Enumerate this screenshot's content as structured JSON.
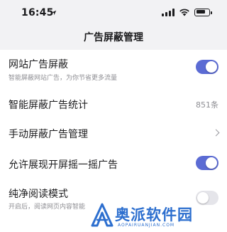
{
  "status_bar": {
    "time": "16:45",
    "icons": [
      "location-arrow-icon",
      "signal-icon",
      "wifi-icon",
      "battery-icon"
    ]
  },
  "page": {
    "title": "广告屏蔽管理"
  },
  "settings": {
    "website_ad_block": {
      "title": "网站广告屏蔽",
      "subtitle": "智能屏蔽网站广告，为你节省更多流量",
      "enabled": true
    },
    "smart_block_stats": {
      "title": "智能屏蔽广告统计",
      "value": "851条"
    },
    "manual_block_manage": {
      "title": "手动屏蔽广告管理"
    },
    "allow_shake_ads": {
      "title": "允许展现开屏摇一摇广告",
      "enabled": true
    },
    "pure_reading": {
      "title": "纯净阅读模式",
      "subtitle": "开启后，阅读网页内容智能",
      "enabled": false
    }
  },
  "watermark": {
    "text": "奥派软件园",
    "url": "AOPAIRUANJIAN.COM"
  },
  "colors": {
    "accent": "#5b6bd4",
    "background": "#f2f2f4",
    "watermark": "#2d6fcf"
  }
}
